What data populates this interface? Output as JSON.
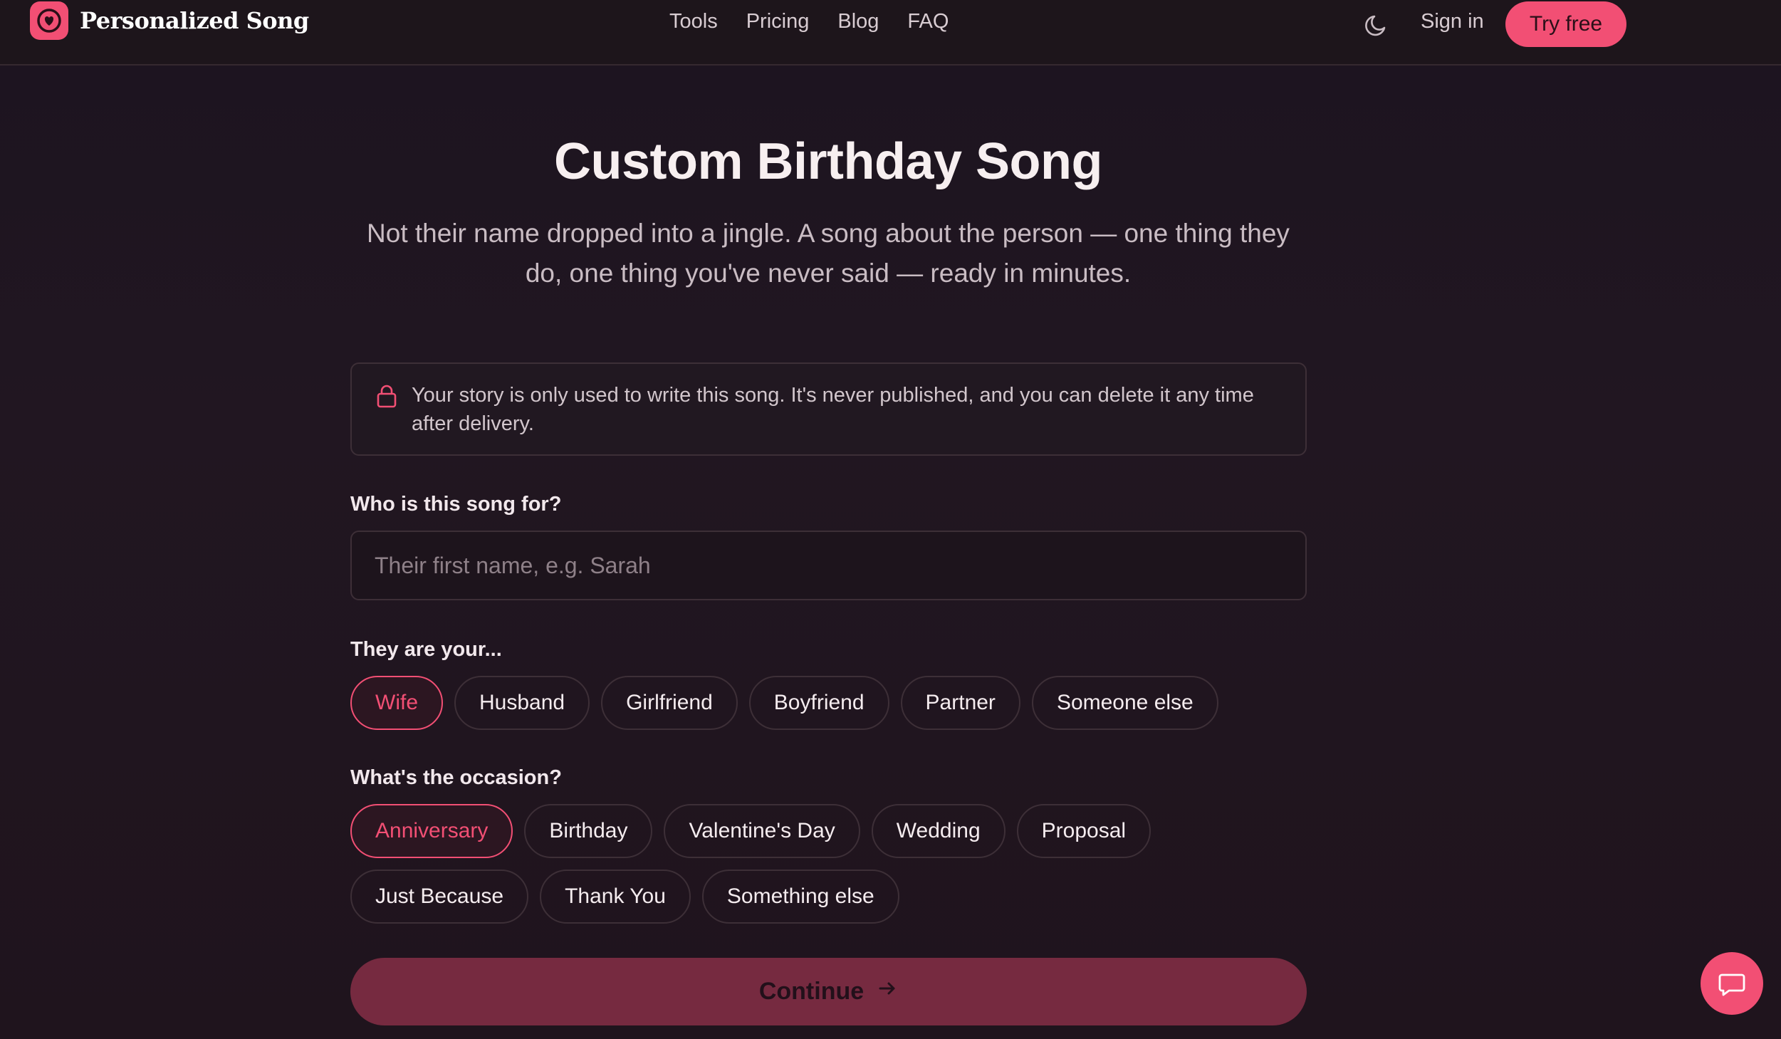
{
  "brand": {
    "name": "Personalized Song",
    "accent": "#f24f74"
  },
  "nav": {
    "links": [
      "Tools",
      "Pricing",
      "Blog",
      "FAQ"
    ],
    "theme_icon": "moon-icon",
    "signin": "Sign in",
    "cta": "Try free"
  },
  "hero": {
    "title": "Custom Birthday Song",
    "subtitle": "Not their name dropped into a jingle. A song about the person — one thing they do, one thing you've never said — ready in minutes."
  },
  "privacy": {
    "icon": "lock-icon",
    "text": "Your story is only used to write this song. It's never published, and you can delete it any time after delivery."
  },
  "form": {
    "name_label": "Who is this song for?",
    "name_placeholder": "Their first name, e.g. Sarah",
    "relation_label": "They are your...",
    "relations": [
      "Wife",
      "Husband",
      "Girlfriend",
      "Boyfriend",
      "Partner",
      "Someone else"
    ],
    "relation_selected": "Wife",
    "occasion_label": "What's the occasion?",
    "occasions_row1": [
      "Anniversary",
      "Birthday",
      "Valentine's Day",
      "Wedding",
      "Proposal"
    ],
    "occasions_row2": [
      "Just Because",
      "Thank You",
      "Something else"
    ],
    "occasion_selected": "Anniversary",
    "continue_label": "Continue"
  },
  "chat": {
    "icon": "chat-bubble-icon"
  }
}
